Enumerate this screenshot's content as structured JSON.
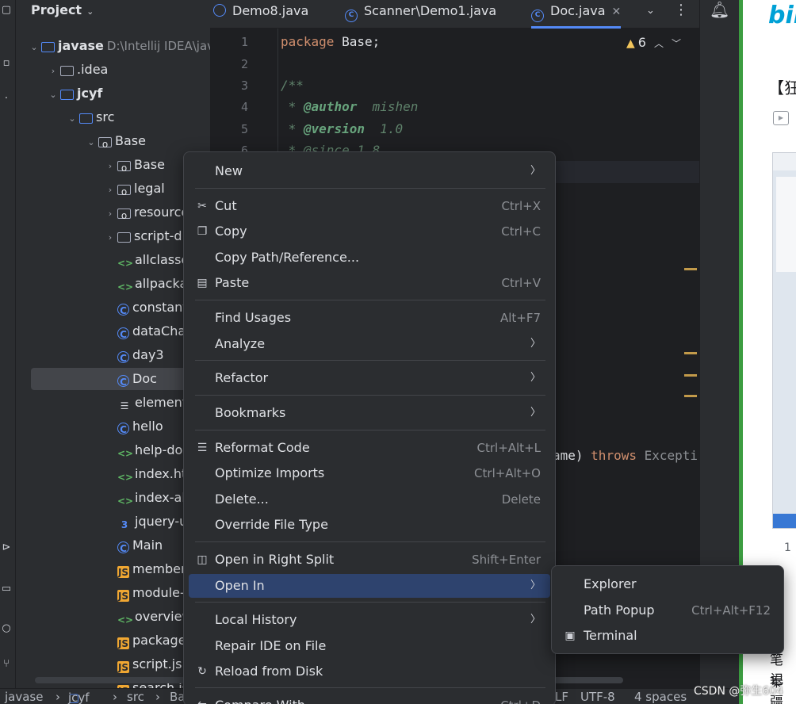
{
  "project_panel": {
    "title": "Project",
    "tree": [
      {
        "label": "javase",
        "path": "D:\\Intellij IDEA\\java",
        "icon": "module-icon",
        "indent": 0,
        "expanded": true
      },
      {
        "label": ".idea",
        "icon": "folder-icon",
        "indent": 1,
        "expanded": false
      },
      {
        "label": "jcyf",
        "icon": "module-icon",
        "indent": 1,
        "expanded": true
      },
      {
        "label": "src",
        "icon": "source-folder-icon",
        "indent": 2,
        "expanded": true
      },
      {
        "label": "Base",
        "icon": "package-icon",
        "indent": 3,
        "expanded": true
      },
      {
        "label": "Base",
        "icon": "package-icon",
        "indent": 4,
        "expanded": false
      },
      {
        "label": "legal",
        "icon": "package-icon",
        "indent": 4,
        "expanded": false
      },
      {
        "label": "resources",
        "icon": "package-icon",
        "indent": 4,
        "expanded": false
      },
      {
        "label": "script-dir",
        "icon": "folder-icon",
        "indent": 4,
        "expanded": false
      },
      {
        "label": "allclasses",
        "icon": "html-icon",
        "indent": 4
      },
      {
        "label": "allpackage",
        "icon": "html-icon",
        "indent": 4
      },
      {
        "label": "constant",
        "icon": "class-icon",
        "indent": 4
      },
      {
        "label": "dataChan",
        "icon": "class-icon",
        "indent": 4
      },
      {
        "label": "day3",
        "icon": "class-icon",
        "indent": 4
      },
      {
        "label": "Doc",
        "icon": "class-icon",
        "indent": 4,
        "selected": true
      },
      {
        "label": "element-li",
        "icon": "list-icon",
        "indent": 4
      },
      {
        "label": "hello",
        "icon": "class-icon",
        "indent": 4
      },
      {
        "label": "help-doc.h",
        "icon": "html-icon",
        "indent": 4
      },
      {
        "label": "index.htm",
        "icon": "html-icon",
        "indent": 4
      },
      {
        "label": "index-all.h",
        "icon": "html-icon",
        "indent": 4
      },
      {
        "label": "jquery-ui.c",
        "icon": "css-icon",
        "indent": 4
      },
      {
        "label": "Main",
        "icon": "class-icon",
        "indent": 4
      },
      {
        "label": "member-s",
        "icon": "js-icon",
        "indent": 4
      },
      {
        "label": "module-se",
        "icon": "js-icon",
        "indent": 4
      },
      {
        "label": "overview-",
        "icon": "html-icon",
        "indent": 4
      },
      {
        "label": "package-s",
        "icon": "js-icon",
        "indent": 4
      },
      {
        "label": "script.js",
        "icon": "js-icon",
        "indent": 4
      },
      {
        "label": "search.js",
        "icon": "js-icon",
        "indent": 4
      }
    ]
  },
  "tabs": [
    {
      "label": "Demo8.java",
      "active": false
    },
    {
      "label": "Scanner\\Demo1.java",
      "active": false
    },
    {
      "label": "Doc.java",
      "active": true
    }
  ],
  "editor": {
    "inspection_count": "6",
    "line_numbers": [
      "1",
      "2",
      "3",
      "4",
      "5",
      "6"
    ],
    "line1_kw": "package",
    "line1_rest": " Base;",
    "line3": "/**",
    "line4_tag": "@author",
    "line4_val": "  mishen",
    "line5_tag": "@version",
    "line5_val": "  1.0",
    "line6": " * @since 1.8",
    "line_main_pre": "ame) ",
    "line_main_kw": "throws",
    "line_main_post": " Excepti"
  },
  "context_menu": {
    "items": [
      {
        "label": "New",
        "submenu": true
      },
      {
        "label": "Cut",
        "shortcut": "Ctrl+X",
        "icon": "scissors-icon"
      },
      {
        "label": "Copy",
        "shortcut": "Ctrl+C",
        "icon": "copy-icon"
      },
      {
        "label": "Copy Path/Reference..."
      },
      {
        "label": "Paste",
        "shortcut": "Ctrl+V",
        "icon": "paste-icon"
      },
      {
        "label": "Find Usages",
        "shortcut": "Alt+F7"
      },
      {
        "label": "Analyze",
        "submenu": true
      },
      {
        "label": "Refactor",
        "submenu": true
      },
      {
        "label": "Bookmarks",
        "submenu": true
      },
      {
        "label": "Reformat Code",
        "shortcut": "Ctrl+Alt+L",
        "icon": "reformat-icon"
      },
      {
        "label": "Optimize Imports",
        "shortcut": "Ctrl+Alt+O"
      },
      {
        "label": "Delete...",
        "shortcut": "Delete"
      },
      {
        "label": "Override File Type"
      },
      {
        "label": "Open in Right Split",
        "shortcut": "Shift+Enter",
        "icon": "split-icon"
      },
      {
        "label": "Open In",
        "submenu": true,
        "highlighted": true
      },
      {
        "label": "Local History",
        "submenu": true
      },
      {
        "label": "Repair IDE on File"
      },
      {
        "label": "Reload from Disk",
        "icon": "reload-icon"
      },
      {
        "label": "Compare With...",
        "shortcut": "Ctrl+D"
      }
    ]
  },
  "open_in_submenu": {
    "items": [
      {
        "label": "Explorer"
      },
      {
        "label": "Path Popup",
        "shortcut": "Ctrl+Alt+F12"
      },
      {
        "label": "Terminal",
        "icon": "terminal-icon"
      }
    ]
  },
  "status_bar": {
    "crumbs": [
      "javase",
      "jcyf",
      "src",
      "Ba"
    ],
    "encoding": "UTF-8",
    "indent": "4 spaces",
    "line_sep": "LF"
  },
  "browser": {
    "logo": "bili",
    "title": "【狂",
    "count": "1",
    "note1": "笔记",
    "note2": "秦疆"
  },
  "watermark": "CSDN @弥生604",
  "colors": {
    "accent": "#548af7",
    "highlight": "#2e436e",
    "background": "#1e1f22",
    "panel": "#2b2d30"
  }
}
